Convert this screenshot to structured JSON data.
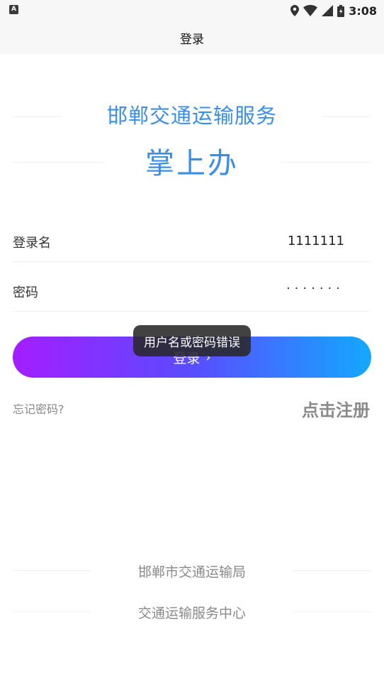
{
  "status_bar": {
    "left_icon": "A",
    "time": "3:08",
    "icons": [
      "location-icon",
      "wifi-icon",
      "signal-icon",
      "battery-icon"
    ]
  },
  "header": {
    "title": "登录"
  },
  "branding": {
    "title": "邯郸交通运输服务",
    "subtitle": "掌上办"
  },
  "form": {
    "username_label": "登录名",
    "username_value": "1111111",
    "password_label": "密码",
    "password_mask": "·······"
  },
  "login_button": {
    "label": "登录",
    "chevron": "›"
  },
  "toast": {
    "message": "用户名或密码错误"
  },
  "links": {
    "forgot": "忘记密码?",
    "register": "点击注册"
  },
  "footer": {
    "line1": "邯郸市交通运输局",
    "line2": "交通运输服务中心"
  },
  "colors": {
    "brand_blue": "#3a8ee6",
    "gradient_start": "#a41dff",
    "gradient_end": "#14a8ff"
  }
}
